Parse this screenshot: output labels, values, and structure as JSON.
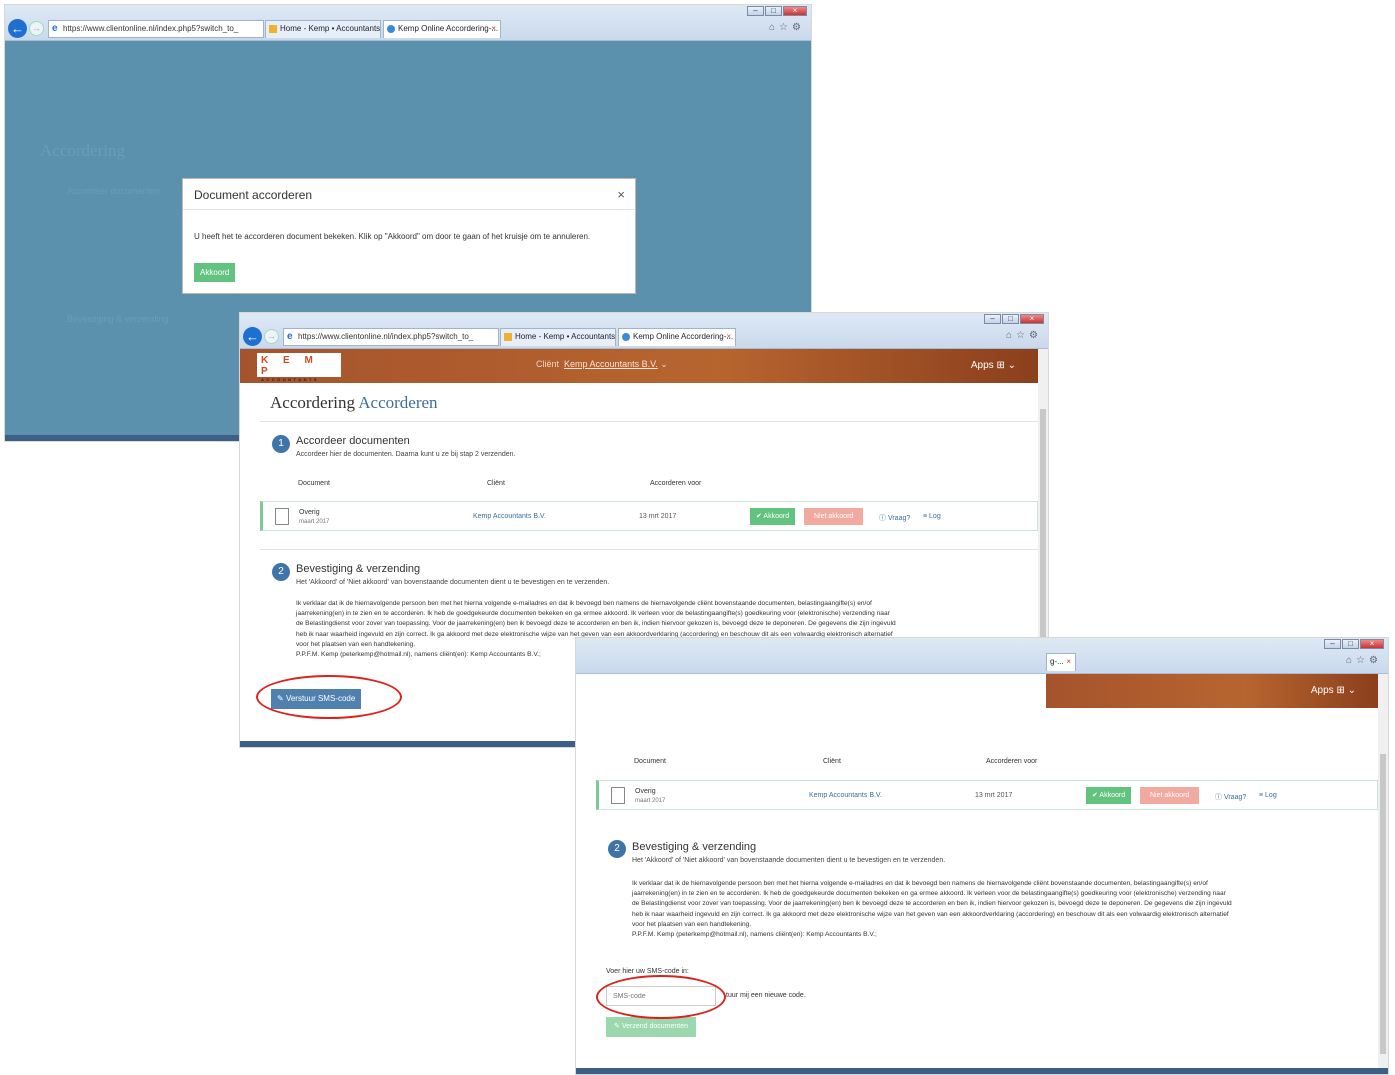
{
  "browser": {
    "address": "https://www.clientonline.nl/index.php5?switch_to_",
    "tabs": [
      "Home - Kemp • Accountants",
      "Kemp Online Accordering-..."
    ],
    "tab_short": "g-..."
  },
  "header": {
    "logo_top": "K E M P",
    "logo_bottom": "ACCOUNTANTS",
    "client_label": "Cliënt",
    "client_name": "Kemp Accountants B.V.",
    "apps_label": "Apps"
  },
  "page": {
    "title_main": "Accordering",
    "title_sub": "Accorderen"
  },
  "step1": {
    "number": "1",
    "title": "Accordeer documenten",
    "subtitle": "Accordeer hier de documenten. Daarna kunt u ze bij stap 2 verzenden.",
    "columns": [
      "Document",
      "Cliënt",
      "Accorderen voor"
    ]
  },
  "row": {
    "doc_name": "Overig",
    "doc_date": "maart 2017",
    "client": "Kemp Accountants B.V.",
    "due": "13 mrt 2017",
    "approve": "✔ Akkoord",
    "reject": "Niet akkoord",
    "question": "ⓘ Vraag?",
    "log": "≡ Log"
  },
  "step2": {
    "number": "2",
    "title": "Bevestiging & verzending",
    "subtitle": "Het 'Akkoord' of 'Niet akkoord' van bovenstaande documenten dient u te bevestigen en te verzenden.",
    "declaration": [
      "Ik verklaar dat ik de hiernavolgende persoon ben met het hierna volgende e-mailadres en dat ik bevoegd ben namens de hiernavolgende cliënt bovenstaande documenten, belastingaangifte(s) en/of",
      "jaarrekening(en) in te zien en te accorderen. Ik heb de goedgekeurde documenten bekeken en ga ermee akkoord. Ik verleen voor de belastingaangifte(s) goedkeuring voor (elektronische) verzending naar",
      "de Belastingdienst voor zover van toepassing. Voor de jaarrekening(en) ben ik bevoegd deze te accorderen en ben ik, indien hiervoor gekozen is, bevoegd deze te deponeren. De gegevens die zijn ingevuld",
      "heb ik naar waarheid ingevuld en zijn correct. Ik ga akkoord met deze elektronische wijze van het geven van een akkoordverklaring (accordering) en beschouw dit als een volwaardig elektronisch alternatief",
      "voor het plaatsen van een handtekening."
    ],
    "signer": "P.P.F.M. Kemp (peterkemp@hotmail.nl), namens cliënt(en): Kemp Accountants B.V.;",
    "sms_button": "Verstuur SMS-code"
  },
  "modal": {
    "title": "Document accorderen",
    "close": "×",
    "body": "U heeft het te accorderen document bekeken. Klik op \"Akkoord\" om door te gaan of het kruisje om te annuleren.",
    "ok": "Akkoord"
  },
  "sms": {
    "label": "Voer hier uw SMS-code in:",
    "placeholder": "SMS-code",
    "resend": "tuur mij een nieuwe code.",
    "send": "Verzend documenten"
  },
  "colors": {
    "header": "#b05c2c",
    "accent": "#3f74a8",
    "approve": "#62c27f",
    "reject": "#f2a9a0",
    "overlay": "#5b91ac",
    "highlight": "#d9231e"
  }
}
